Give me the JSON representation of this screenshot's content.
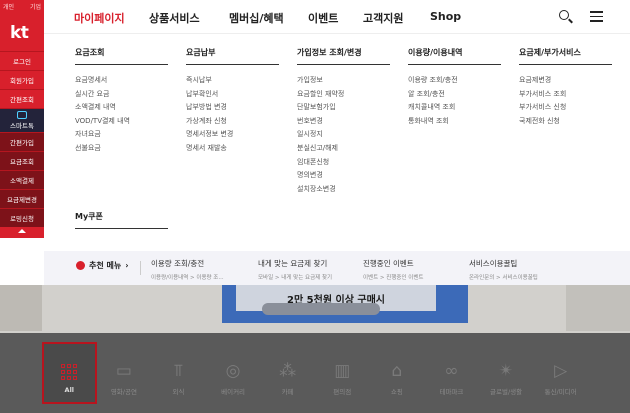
{
  "sidebar": {
    "top_links": [
      "개인",
      "기업"
    ],
    "logo": "kt",
    "items": [
      "로그인",
      "회원가입",
      "간편조회",
      "스마트톡",
      "간편가입",
      "요금조회",
      "소액결제",
      "요금제변경",
      "로밍신청"
    ]
  },
  "topnav": {
    "items": [
      "마이페이지",
      "상품서비스",
      "멤버십/혜택",
      "이벤트",
      "고객지원",
      "Shop"
    ],
    "active": "마이페이지",
    "search_icon": "search-icon",
    "menu_icon": "hamburger-menu-icon"
  },
  "mega": {
    "columns": [
      {
        "title": "요금조회",
        "items": [
          "요금명세서",
          "실시간 요금",
          "소액결제 내역",
          "VOD/TV결제 내역",
          "자녀요금",
          "선불요금"
        ]
      },
      {
        "title": "요금납부",
        "items": [
          "즉시납부",
          "납부확인서",
          "납부방법 변경",
          "가상계좌 신청",
          "명세서정보 변경",
          "명세서 재발송"
        ]
      },
      {
        "title": "가입정보 조회/변경",
        "items": [
          "가입정보",
          "요금할인 재약정",
          "단말보험가입",
          "번호변경",
          "일시정지",
          "분실신고/해제",
          "임대폰신청",
          "명의변경",
          "설치장소변경"
        ]
      },
      {
        "title": "이용량/이용내역",
        "items": [
          "이용량 조회/충전",
          "알 조회/충전",
          "캐치콜내역 조회",
          "통화내역 조회"
        ]
      },
      {
        "title": "요금제/부가서비스",
        "items": [
          "요금제변경",
          "부가서비스 조회",
          "부가서비스 신청",
          "국제전화 신청"
        ]
      }
    ],
    "my_coupon": "My쿠폰"
  },
  "recommend": {
    "title": "추천 메뉴",
    "items": [
      {
        "title": "이용량 조회/충전",
        "path": "이용량/이용내역 > 이용량 조..."
      },
      {
        "title": "내게 맞는 요금제 찾기",
        "path": "모바일 > 내게 맞는 요금제 찾기"
      },
      {
        "title": "진행중인 이벤트",
        "path": "이벤트 > 진행중인 이벤트"
      },
      {
        "title": "서비스이용꿀팁",
        "path": "온라인문의 > 서비스이용꿀팁"
      }
    ]
  },
  "background": {
    "banner_text": "2만 5천원 이상 구매시",
    "categories": [
      {
        "label": "All",
        "icon": "all-grid-icon"
      },
      {
        "label": "영화/공연",
        "icon": "ticket-icon"
      },
      {
        "label": "외식",
        "icon": "fork-icon"
      },
      {
        "label": "베이커리",
        "icon": "donut-icon"
      },
      {
        "label": "카페",
        "icon": "coffee-bean-icon"
      },
      {
        "label": "편의점",
        "icon": "store-icon"
      },
      {
        "label": "쇼핑",
        "icon": "shopping-bag-icon"
      },
      {
        "label": "테마파크",
        "icon": "infinity-icon"
      },
      {
        "label": "글로벌/생활",
        "icon": "star-burst-icon"
      },
      {
        "label": "통신/미디어",
        "icon": "tv-play-icon"
      }
    ],
    "active_category": "All"
  },
  "colors": {
    "brand_red": "#d8202c",
    "sidebar_dark": "#7d1219"
  }
}
